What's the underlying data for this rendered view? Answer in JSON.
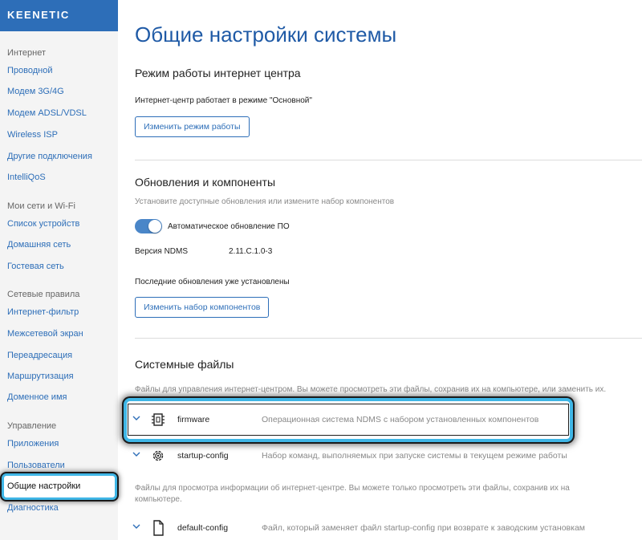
{
  "brand": {
    "logo": "KEENETIC"
  },
  "sidebar": {
    "groups": [
      {
        "title": "Интернет"
      },
      {
        "title": "Мои сети и Wi-Fi"
      },
      {
        "title": "Сетевые правила"
      },
      {
        "title": "Управление"
      }
    ],
    "items": [
      {
        "label": "Проводной"
      },
      {
        "label": "Модем 3G/4G"
      },
      {
        "label": "Модем ADSL/VDSL"
      },
      {
        "label": "Wireless ISP"
      },
      {
        "label": "Другие подключения"
      },
      {
        "label": "IntelliQoS"
      },
      {
        "label": "Список устройств"
      },
      {
        "label": "Домашняя сеть"
      },
      {
        "label": "Гостевая сеть"
      },
      {
        "label": "Интернет-фильтр"
      },
      {
        "label": "Межсетевой экран"
      },
      {
        "label": "Переадресация"
      },
      {
        "label": "Маршрутизация"
      },
      {
        "label": "Доменное имя"
      },
      {
        "label": "Приложения"
      },
      {
        "label": "Пользователи"
      },
      {
        "label": "Общие настройки",
        "active": true
      },
      {
        "label": "Диагностика"
      }
    ]
  },
  "main": {
    "title": "Общие настройки системы",
    "mode": {
      "title": "Режим работы интернет центра",
      "status": "Интернет-центр работает в режиме \"Основной\"",
      "button": "Изменить режим работы"
    },
    "updates": {
      "title": "Обновления и компоненты",
      "hint": "Установите доступные обновления или измените набор компонентов",
      "auto_update_label": "Автоматическое обновление ПО",
      "auto_update_on": true,
      "version_label": "Версия NDMS",
      "version_value": "2.11.C.1.0-3",
      "status": "Последние обновления уже установлены",
      "button": "Изменить набор компонентов"
    },
    "files": {
      "title": "Системные файлы",
      "hint1": "Файлы для управления интернет-центром. Вы можете просмотреть эти файлы, сохранив их на компьютере, или заменить их.",
      "hint2_line1": "Файлы для просмотра информации об интернет-центре. Вы можете только просмотреть эти файлы, сохранив их на",
      "hint2_line2": "компьютере.",
      "rows": [
        {
          "name": "firmware",
          "desc": "Операционная система NDMS с набором установленных компонентов",
          "icon": "chip-icon"
        },
        {
          "name": "startup-config",
          "desc": "Набор команд, выполняемых при запуске системы в текущем режиме работы",
          "icon": "gear-icon"
        },
        {
          "name": "default-config",
          "desc": "Файл, который заменяет файл startup-config при возврате к заводским установкам",
          "icon": "file-icon"
        }
      ]
    }
  },
  "colors": {
    "accent": "#2d6eb8",
    "highlight": "#3fb6e6"
  }
}
